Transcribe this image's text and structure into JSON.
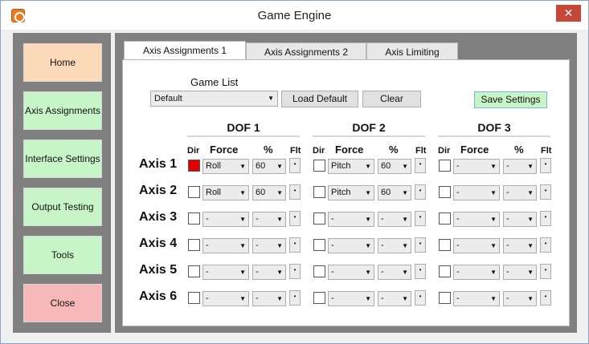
{
  "window": {
    "title": "Game Engine",
    "close_glyph": "✕",
    "app_icon": "power-icon"
  },
  "sidebar": {
    "items": [
      {
        "label": "Home",
        "color": "#fcd9b8"
      },
      {
        "label": "Axis Assignments",
        "color": "#c8f5c8"
      },
      {
        "label": "Interface Settings",
        "color": "#c8f5c8"
      },
      {
        "label": "Output Testing",
        "color": "#c8f5c8"
      },
      {
        "label": "Tools",
        "color": "#c8f5c8"
      },
      {
        "label": "Close",
        "color": "#f7b8b8"
      }
    ]
  },
  "tabs": [
    {
      "label": "Axis Assignments 1",
      "active": true
    },
    {
      "label": "Axis Assignments 2",
      "active": false
    },
    {
      "label": "Axis Limiting",
      "active": false
    }
  ],
  "game_list": {
    "label": "Game List",
    "selected": "Default",
    "load_default_label": "Load Default",
    "clear_label": "Clear",
    "save_label": "Save Settings"
  },
  "grid": {
    "dof_titles": [
      "DOF 1",
      "DOF 2",
      "DOF 3"
    ],
    "col_dir": "Dir",
    "col_force": "Force",
    "col_pct": "%",
    "col_flt": "Flt",
    "flt_glyph": "•",
    "axes": [
      {
        "label": "Axis 1",
        "dofs": [
          {
            "dir": true,
            "force": "Roll",
            "pct": "60"
          },
          {
            "dir": false,
            "force": "Pitch",
            "pct": "60"
          },
          {
            "dir": false,
            "force": "-",
            "pct": "-"
          }
        ]
      },
      {
        "label": "Axis 2",
        "dofs": [
          {
            "dir": false,
            "force": "Roll",
            "pct": "60"
          },
          {
            "dir": false,
            "force": "Pitch",
            "pct": "60"
          },
          {
            "dir": false,
            "force": "-",
            "pct": "-"
          }
        ]
      },
      {
        "label": "Axis 3",
        "dofs": [
          {
            "dir": false,
            "force": "-",
            "pct": "-"
          },
          {
            "dir": false,
            "force": "-",
            "pct": "-"
          },
          {
            "dir": false,
            "force": "-",
            "pct": "-"
          }
        ]
      },
      {
        "label": "Axis 4",
        "dofs": [
          {
            "dir": false,
            "force": "-",
            "pct": "-"
          },
          {
            "dir": false,
            "force": "-",
            "pct": "-"
          },
          {
            "dir": false,
            "force": "-",
            "pct": "-"
          }
        ]
      },
      {
        "label": "Axis 5",
        "dofs": [
          {
            "dir": false,
            "force": "-",
            "pct": "-"
          },
          {
            "dir": false,
            "force": "-",
            "pct": "-"
          },
          {
            "dir": false,
            "force": "-",
            "pct": "-"
          }
        ]
      },
      {
        "label": "Axis 6",
        "dofs": [
          {
            "dir": false,
            "force": "-",
            "pct": "-"
          },
          {
            "dir": false,
            "force": "-",
            "pct": "-"
          },
          {
            "dir": false,
            "force": "-",
            "pct": "-"
          }
        ]
      }
    ]
  }
}
